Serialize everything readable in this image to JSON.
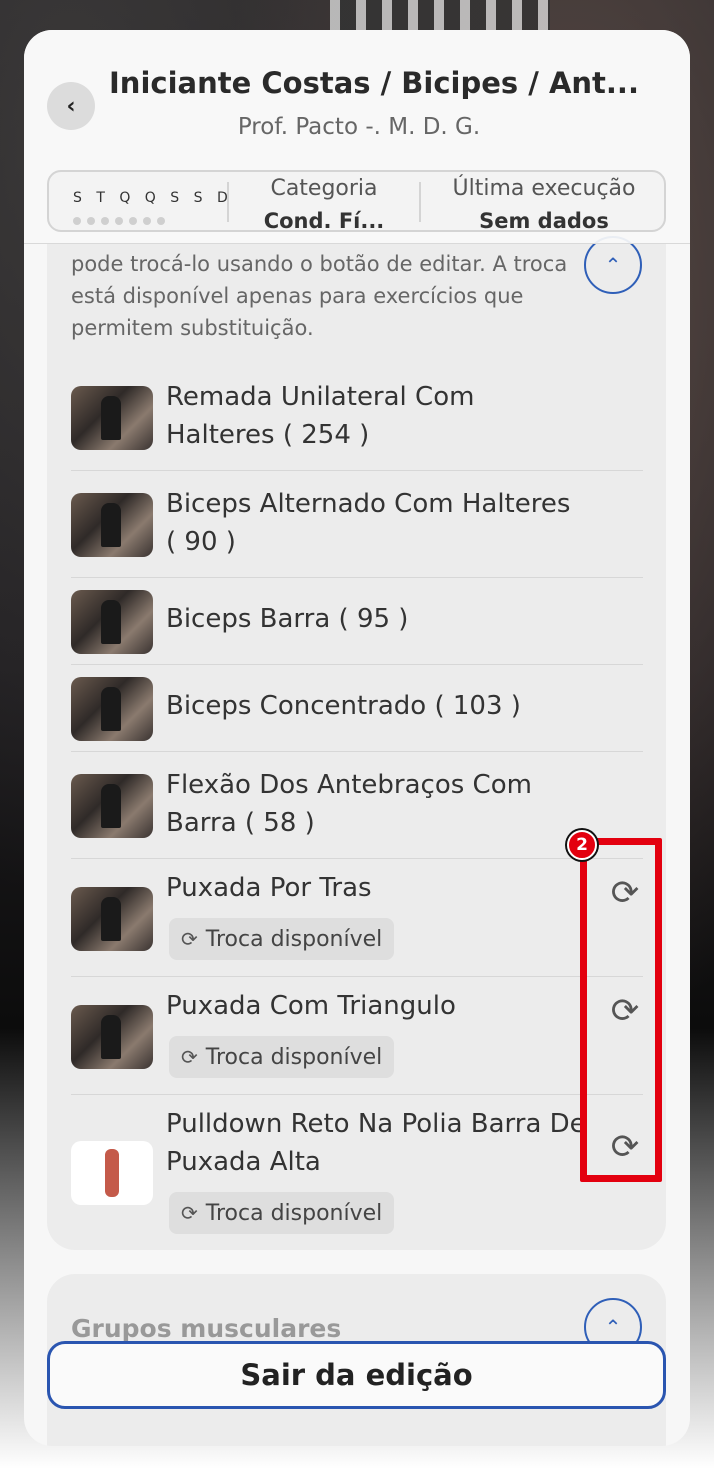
{
  "header": {
    "back_icon": "chevron-left-icon",
    "title": "Iniciante Costas / Bicipes / Ant...",
    "subtitle": "Prof. Pacto -. M. D. G.",
    "days": "S T Q Q S S D",
    "category_label": "Categoria",
    "category_value": "Cond. Fí...",
    "last_exec_label": "Última execução",
    "last_exec_value": "Sem dados"
  },
  "exercises_card": {
    "description": "pode trocá-lo usando o botão de editar. A troca está disponível apenas para exercícios que permitem substituição.",
    "collapse_icon": "chevron-up-icon",
    "items": [
      {
        "name": "Remada Unilateral Com Halteres ( 254 )",
        "swappable": false
      },
      {
        "name": "Biceps Alternado Com Halteres ( 90 )",
        "swappable": false
      },
      {
        "name": "Biceps Barra  ( 95 )",
        "swappable": false
      },
      {
        "name": "Biceps Concentrado ( 103 )",
        "swappable": false
      },
      {
        "name": "Flexão Dos Antebraços Com Barra ( 58 )",
        "swappable": false
      },
      {
        "name": "Puxada Por Tras",
        "swappable": true,
        "badge": "Troca disponível"
      },
      {
        "name": "Puxada Com Triangulo",
        "swappable": true,
        "badge": "Troca disponível"
      },
      {
        "name": "Pulldown Reto Na Polia Barra De Puxada Alta",
        "swappable": true,
        "badge": "Troca disponível"
      }
    ]
  },
  "annotation": {
    "marker": "2",
    "color": "#e3000f"
  },
  "muscle_groups": {
    "title": "Grupos musculares",
    "toggle_icon": "chevron-up-icon"
  },
  "footer": {
    "exit_label": "Sair da edição"
  },
  "colors": {
    "accent": "#2a55b0",
    "highlight": "#e3000f"
  }
}
